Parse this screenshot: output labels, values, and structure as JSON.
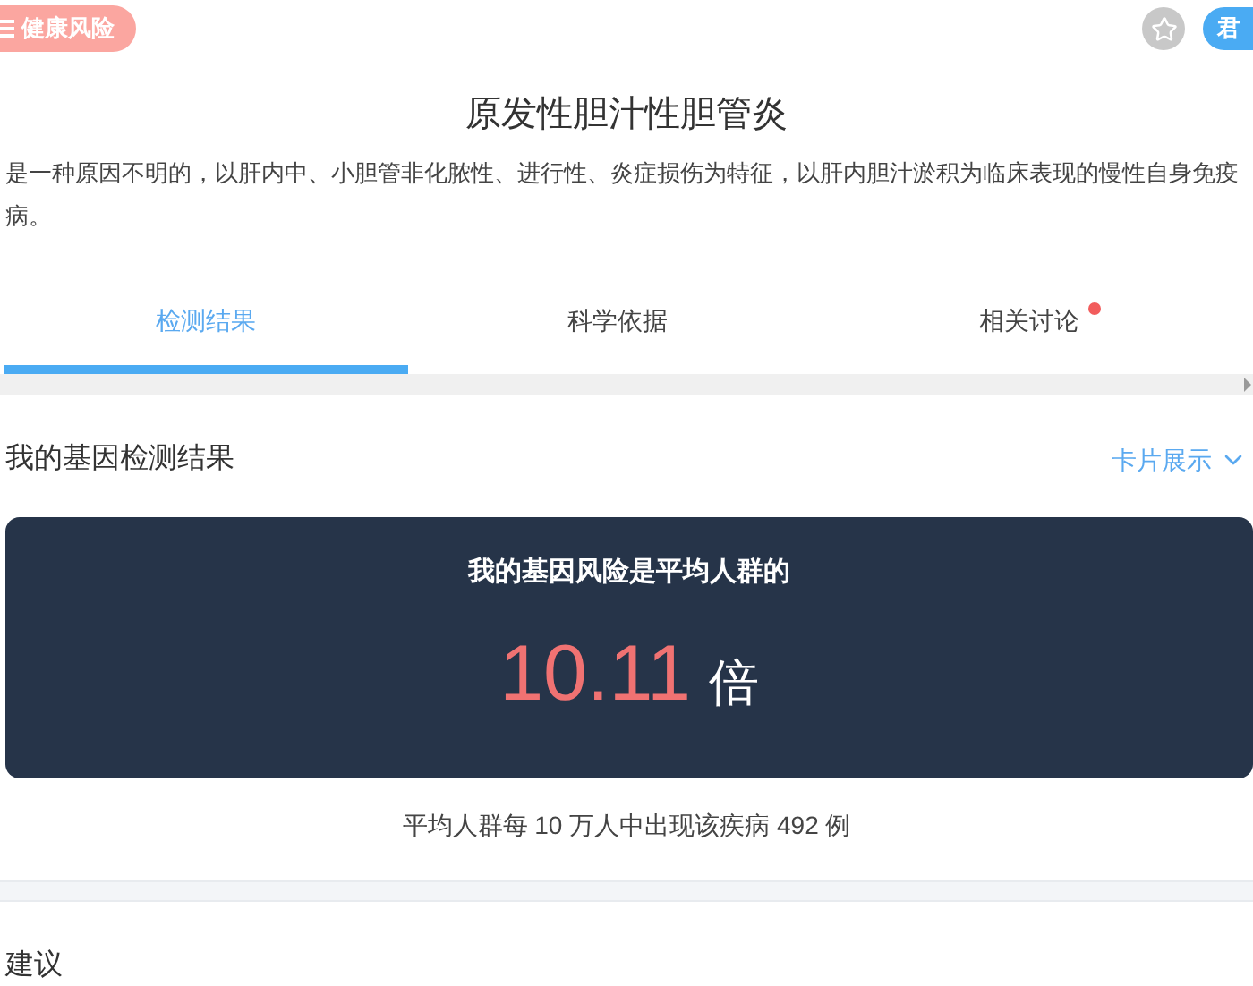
{
  "header": {
    "category": "健康风险",
    "avatar_text": "君",
    "favorited": false
  },
  "title": "原发性胆汁性胆管炎",
  "description": "是一种原因不明的，以肝内中、小胆管非化脓性、进行性、炎症损伤为特征，以肝内胆汁淤积为临床表现的慢性自身免疫病。",
  "tabs": [
    {
      "label": "检测结果",
      "selected": true,
      "has_dot": false
    },
    {
      "label": "科学依据",
      "selected": false,
      "has_dot": false
    },
    {
      "label": "相关讨论",
      "selected": false,
      "has_dot": true
    }
  ],
  "section": {
    "title": "我的基因检测结果",
    "view_toggle": "卡片展示"
  },
  "risk_card": {
    "caption": "我的基因风险是平均人群的",
    "value": "10.11",
    "unit": "倍"
  },
  "incidence_note": "平均人群每 10 万人中出现该疾病 492 例",
  "next_section": {
    "title": "建议"
  }
}
